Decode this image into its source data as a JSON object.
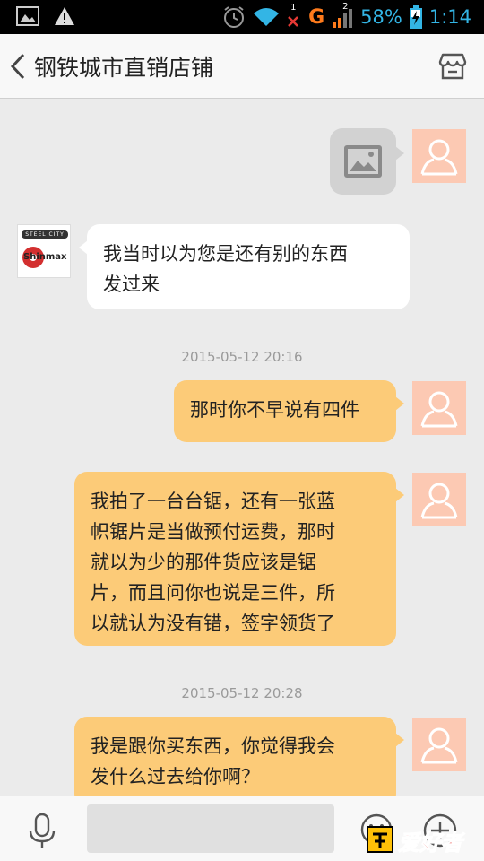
{
  "status_bar": {
    "battery": "58%",
    "time": "1:14",
    "network": "G",
    "sim_badge_1": "1",
    "sim_badge_2": "2",
    "icons": [
      "image-notification-icon",
      "warning-icon",
      "alarm-icon",
      "wifi-icon",
      "no-signal-icon",
      "signal-icon",
      "battery-charging-icon"
    ]
  },
  "header": {
    "title": "钢铁城市直销店铺",
    "back_icon": "chevron-left-icon",
    "shop_icon": "store-icon"
  },
  "shop_avatar": {
    "logo_top": "STEEL CITY",
    "logo_bottom": "Shinmax"
  },
  "messages": [
    {
      "direction": "out",
      "kind": "image",
      "icon": "image-placeholder-icon"
    },
    {
      "direction": "in",
      "lines": [
        "我当时以为您是还有别的东西",
        "发过来"
      ]
    },
    {
      "kind": "timestamp",
      "text": "2015-05-12 20:16"
    },
    {
      "direction": "out",
      "lines": [
        "那时你不早说有四件"
      ]
    },
    {
      "direction": "out",
      "lines": [
        "我拍了一台台锯，还有一张蓝",
        "帜锯片是当做预付运费，那时",
        "就以为少的那件货应该是锯",
        "片，而且问你也说是三件，所",
        "以就认为没有错，签字领货了"
      ]
    },
    {
      "kind": "timestamp",
      "text": "2015-05-12 20:28"
    },
    {
      "direction": "out",
      "lines": [
        "我是跟你买东西，你觉得我会",
        "发什么过去给你啊？"
      ]
    }
  ],
  "input_bar": {
    "placeholder": "",
    "icons": [
      "microphone-icon",
      "emoji-icon",
      "plus-icon"
    ]
  },
  "watermark": {
    "text": "爱好者"
  },
  "colors": {
    "outgoing_bubble": "#fccb78",
    "incoming_bubble": "#ffffff",
    "avatar_bg": "#fcc9b3",
    "background": "#ebebeb",
    "status_accent": "#33b5e5"
  }
}
